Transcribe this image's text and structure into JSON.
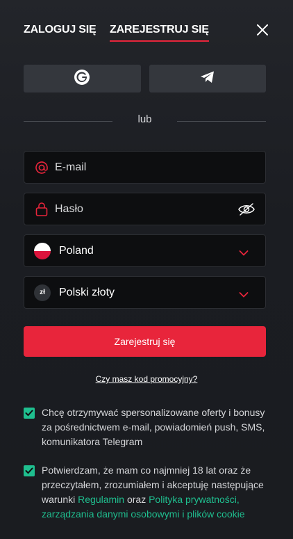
{
  "tabs": {
    "login": "ZALOGUJ SIĘ",
    "register": "ZAREJESTRUJ SIĘ"
  },
  "social": {
    "google_icon": "google-icon",
    "telegram_icon": "telegram-icon"
  },
  "divider_text": "lub",
  "form": {
    "email": {
      "placeholder": "E-mail",
      "icon": "at-icon"
    },
    "password": {
      "placeholder": "Hasło",
      "icon": "lock-icon",
      "toggle_icon": "eye-off-icon"
    },
    "country": {
      "value": "Poland",
      "icon": "flag-poland"
    },
    "currency": {
      "value": "Polski złoty",
      "badge": "zł"
    },
    "submit_label": "Zarejestruj się",
    "promo_link": "Czy masz kod promocyjny?"
  },
  "consents": {
    "marketing": "Chcę otrzymywać spersonalizowane oferty i bonusy za pośrednictwem e-mail, powiadomień push, SMS, komunikatora Telegram",
    "terms_prefix": "Potwierdzam, że mam co najmniej 18 lat oraz że przeczytałem, zrozumiałem i akceptuję następujące warunki ",
    "terms_link": "Regulamin",
    "terms_and": " oraz ",
    "privacy_link": "Polityka prywatności, zarządzania danymi osobowymi i plików cookie"
  },
  "colors": {
    "accent_red": "#e8253b",
    "accent_green": "#1fbf8f",
    "background": "#1b1d22",
    "field_bg": "#0d0e10"
  }
}
